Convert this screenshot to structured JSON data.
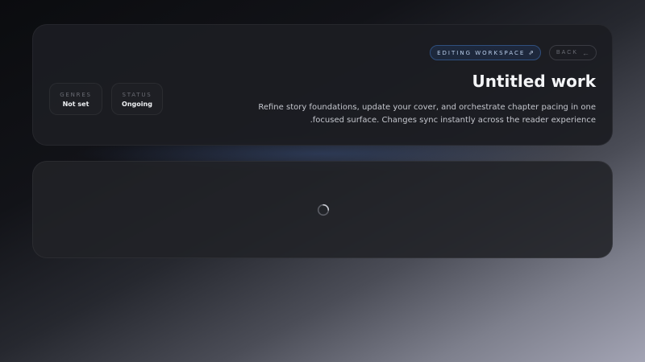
{
  "workspace": {
    "badge_label": "EDITING WORKSPACE",
    "badge_icon": "link-icon",
    "back_label": "BACK",
    "back_icon": "arrow-left-icon",
    "title": "Untitled work",
    "description": "Refine story foundations, update your cover, and orchestrate chapter pacing in one focused surface. Changes sync instantly across the reader experience."
  },
  "meta": {
    "genres_label": "GENRES",
    "genres_value": "Not set",
    "status_label": "STATUS",
    "status_value": "Ongoing"
  },
  "content": {
    "loading_icon": "spinner-icon"
  },
  "colors": {
    "accent": "#2f4f7e",
    "card_bg": "#1c1d22"
  }
}
